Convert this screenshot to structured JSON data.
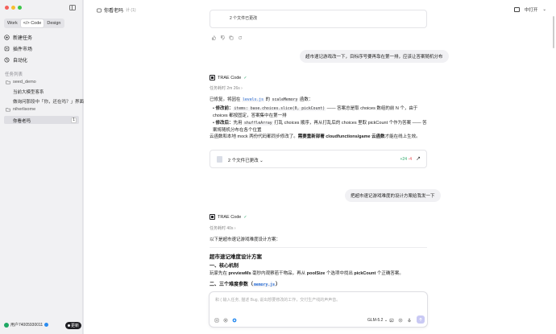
{
  "window": {
    "traffic_colors": [
      "#f4605a",
      "#f7be30",
      "#3ec74a"
    ]
  },
  "sidebar": {
    "modes": [
      {
        "label": "Work"
      },
      {
        "label": "</> Code"
      },
      {
        "label": "Design"
      }
    ],
    "nav": [
      {
        "label": "新建任务"
      },
      {
        "label": "插件市场"
      },
      {
        "label": "自动化"
      }
    ],
    "section_label": "任务列表",
    "groups": [
      {
        "label": "seed_demo",
        "tasks": [
          "当前大模型客系",
          "做询问那段中「你，还在吗？」界面"
        ]
      },
      {
        "label": "niherlisome",
        "tasks": []
      }
    ],
    "active_task": {
      "label": "你看老吗",
      "shortcut": "1"
    },
    "user": {
      "name": "用户74005930011"
    },
    "update_button": "更新"
  },
  "topbar": {
    "title": "你看老吗",
    "subtitle": "计 (1)",
    "right_label": "中打开"
  },
  "conversation": {
    "top_card_text": "2 个文件已更改",
    "user_msg_1": "超市速记游戏改一下，目标序号要再靠在第一排，应该让答案随机分布",
    "agent_name": "TRAE Code",
    "agent_tag": "✓",
    "meta_1": "任务耗时 2m 26s ›",
    "para_1": {
      "pre": "已修复。将因在 ",
      "file": "levels.js",
      "mid": " 的 ",
      "fn": "scaleMemory",
      "post": " 函数："
    },
    "bullet_1": {
      "lead": "修改前：",
      "code": "items: base.choices.slice(0, pickCount)",
      "rest": " —— 答案总是取 choices 数组的前 N 个，由于 choices 都按固定，答案集中在第一排"
    },
    "bullet_2": {
      "lead": "修改后：",
      "code_pre": "先用 ",
      "code": "shuffleArray",
      "rest": " 打乱 choices 顺序，再从打乱后的 choices 里取 pickCount 个作为答案 —— 答案将随机分布在各个位置"
    },
    "para_2": {
      "text": "云函数和本地 mock 两份代码都同步修改了。",
      "bold": "需要重新部署 cloudfunctions/game 云函数",
      "tail": "才能在线上生效。"
    },
    "changes": {
      "label": "2 个文件已更改",
      "chevron": "⌄",
      "plus": "+24",
      "minus": "-4",
      "arrow": "↗"
    },
    "user_msg_2": "把超市速记游戏难度的设计方案给我发一下",
    "meta_2": "任务耗时 40s ›",
    "para_3": "以下是超市速记游戏难度设计方案：",
    "heading_main": "超市速记难度设计方案",
    "heading_1": "一、核心机制",
    "para_4": {
      "pre": "玩家先在 ",
      "a": "previewMs",
      "mid1": " 毫秒内观察若干物品，再从 ",
      "b": "poolSize",
      "mid2": " 个选项中找出 ",
      "c": "pickCount",
      "post": " 个正确答案。"
    },
    "heading_2_pre": "二、三个难度参数（",
    "heading_2_code": "memory.js",
    "heading_2_post": "）"
  },
  "composer": {
    "placeholder": "和 ( 输入任务, 描述 Bug, 说出想要修改的工作，交付生产线的声声音。",
    "model": "GLM-5.2 ⌄"
  }
}
